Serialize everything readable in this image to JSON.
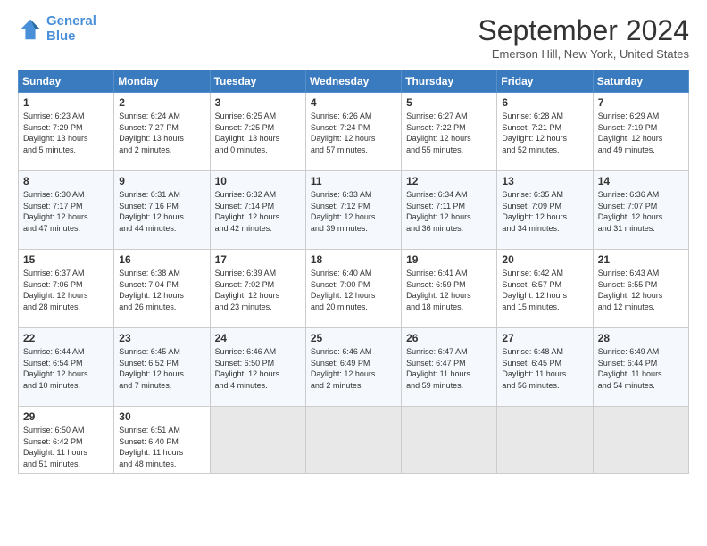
{
  "header": {
    "logo_line1": "General",
    "logo_line2": "Blue",
    "month_title": "September 2024",
    "location": "Emerson Hill, New York, United States"
  },
  "weekdays": [
    "Sunday",
    "Monday",
    "Tuesday",
    "Wednesday",
    "Thursday",
    "Friday",
    "Saturday"
  ],
  "weeks": [
    [
      {
        "day": "1",
        "info": "Sunrise: 6:23 AM\nSunset: 7:29 PM\nDaylight: 13 hours\nand 5 minutes."
      },
      {
        "day": "2",
        "info": "Sunrise: 6:24 AM\nSunset: 7:27 PM\nDaylight: 13 hours\nand 2 minutes."
      },
      {
        "day": "3",
        "info": "Sunrise: 6:25 AM\nSunset: 7:25 PM\nDaylight: 13 hours\nand 0 minutes."
      },
      {
        "day": "4",
        "info": "Sunrise: 6:26 AM\nSunset: 7:24 PM\nDaylight: 12 hours\nand 57 minutes."
      },
      {
        "day": "5",
        "info": "Sunrise: 6:27 AM\nSunset: 7:22 PM\nDaylight: 12 hours\nand 55 minutes."
      },
      {
        "day": "6",
        "info": "Sunrise: 6:28 AM\nSunset: 7:21 PM\nDaylight: 12 hours\nand 52 minutes."
      },
      {
        "day": "7",
        "info": "Sunrise: 6:29 AM\nSunset: 7:19 PM\nDaylight: 12 hours\nand 49 minutes."
      }
    ],
    [
      {
        "day": "8",
        "info": "Sunrise: 6:30 AM\nSunset: 7:17 PM\nDaylight: 12 hours\nand 47 minutes."
      },
      {
        "day": "9",
        "info": "Sunrise: 6:31 AM\nSunset: 7:16 PM\nDaylight: 12 hours\nand 44 minutes."
      },
      {
        "day": "10",
        "info": "Sunrise: 6:32 AM\nSunset: 7:14 PM\nDaylight: 12 hours\nand 42 minutes."
      },
      {
        "day": "11",
        "info": "Sunrise: 6:33 AM\nSunset: 7:12 PM\nDaylight: 12 hours\nand 39 minutes."
      },
      {
        "day": "12",
        "info": "Sunrise: 6:34 AM\nSunset: 7:11 PM\nDaylight: 12 hours\nand 36 minutes."
      },
      {
        "day": "13",
        "info": "Sunrise: 6:35 AM\nSunset: 7:09 PM\nDaylight: 12 hours\nand 34 minutes."
      },
      {
        "day": "14",
        "info": "Sunrise: 6:36 AM\nSunset: 7:07 PM\nDaylight: 12 hours\nand 31 minutes."
      }
    ],
    [
      {
        "day": "15",
        "info": "Sunrise: 6:37 AM\nSunset: 7:06 PM\nDaylight: 12 hours\nand 28 minutes."
      },
      {
        "day": "16",
        "info": "Sunrise: 6:38 AM\nSunset: 7:04 PM\nDaylight: 12 hours\nand 26 minutes."
      },
      {
        "day": "17",
        "info": "Sunrise: 6:39 AM\nSunset: 7:02 PM\nDaylight: 12 hours\nand 23 minutes."
      },
      {
        "day": "18",
        "info": "Sunrise: 6:40 AM\nSunset: 7:00 PM\nDaylight: 12 hours\nand 20 minutes."
      },
      {
        "day": "19",
        "info": "Sunrise: 6:41 AM\nSunset: 6:59 PM\nDaylight: 12 hours\nand 18 minutes."
      },
      {
        "day": "20",
        "info": "Sunrise: 6:42 AM\nSunset: 6:57 PM\nDaylight: 12 hours\nand 15 minutes."
      },
      {
        "day": "21",
        "info": "Sunrise: 6:43 AM\nSunset: 6:55 PM\nDaylight: 12 hours\nand 12 minutes."
      }
    ],
    [
      {
        "day": "22",
        "info": "Sunrise: 6:44 AM\nSunset: 6:54 PM\nDaylight: 12 hours\nand 10 minutes."
      },
      {
        "day": "23",
        "info": "Sunrise: 6:45 AM\nSunset: 6:52 PM\nDaylight: 12 hours\nand 7 minutes."
      },
      {
        "day": "24",
        "info": "Sunrise: 6:46 AM\nSunset: 6:50 PM\nDaylight: 12 hours\nand 4 minutes."
      },
      {
        "day": "25",
        "info": "Sunrise: 6:46 AM\nSunset: 6:49 PM\nDaylight: 12 hours\nand 2 minutes."
      },
      {
        "day": "26",
        "info": "Sunrise: 6:47 AM\nSunset: 6:47 PM\nDaylight: 11 hours\nand 59 minutes."
      },
      {
        "day": "27",
        "info": "Sunrise: 6:48 AM\nSunset: 6:45 PM\nDaylight: 11 hours\nand 56 minutes."
      },
      {
        "day": "28",
        "info": "Sunrise: 6:49 AM\nSunset: 6:44 PM\nDaylight: 11 hours\nand 54 minutes."
      }
    ],
    [
      {
        "day": "29",
        "info": "Sunrise: 6:50 AM\nSunset: 6:42 PM\nDaylight: 11 hours\nand 51 minutes."
      },
      {
        "day": "30",
        "info": "Sunrise: 6:51 AM\nSunset: 6:40 PM\nDaylight: 11 hours\nand 48 minutes."
      },
      {
        "day": "",
        "info": ""
      },
      {
        "day": "",
        "info": ""
      },
      {
        "day": "",
        "info": ""
      },
      {
        "day": "",
        "info": ""
      },
      {
        "day": "",
        "info": ""
      }
    ]
  ]
}
